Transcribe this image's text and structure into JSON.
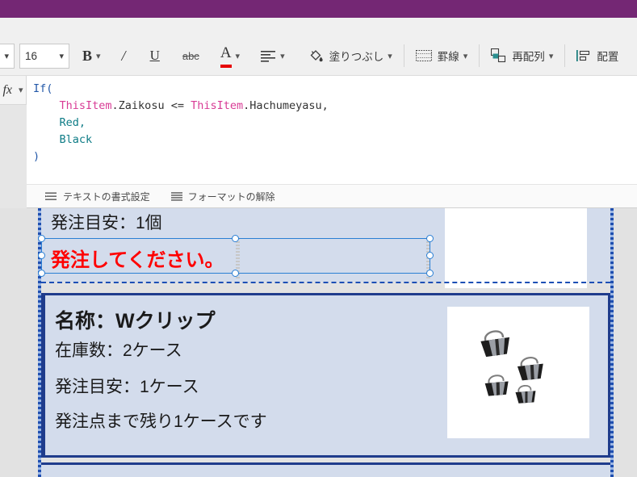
{
  "app": {
    "title_bar_color": "#742774",
    "canvas_bg": "#e2e2e2"
  },
  "toolbar": {
    "font_family_value": "",
    "font_size_value": "16",
    "bold_label": "B",
    "italic_label": "/",
    "underline_label": "U",
    "strikethrough_label": "abc",
    "font_color_label": "A",
    "font_color_swatch": "#e60000",
    "align_label": "",
    "fill_label": "塗りつぶし",
    "border_label": "罫線",
    "reorder_label": "再配列",
    "arrange_label": "配置"
  },
  "formula": {
    "fx_label": "fx",
    "lines": [
      [
        {
          "t": "If(",
          "c": "fn"
        }
      ],
      [
        {
          "t": "    ",
          "c": "plain"
        },
        {
          "t": "ThisItem",
          "c": "obj"
        },
        {
          "t": ".Zaikosu <= ",
          "c": "plain"
        },
        {
          "t": "ThisItem",
          "c": "obj"
        },
        {
          "t": ".Hachumeyasu,",
          "c": "plain"
        }
      ],
      [
        {
          "t": "    ",
          "c": "plain"
        },
        {
          "t": "Red,",
          "c": "val"
        }
      ],
      [
        {
          "t": "    ",
          "c": "plain"
        },
        {
          "t": "Black",
          "c": "val"
        }
      ],
      [
        {
          "t": ")",
          "c": "fn"
        }
      ]
    ],
    "text_format_label": "テキストの書式設定",
    "clear_format_label": "フォーマットの解除"
  },
  "gallery": {
    "items": [
      {
        "lines": [
          "発注目安：1個"
        ],
        "alert_text": "発注してください。",
        "alert_color": "#ff0000",
        "image_alt": "stapler-photo"
      },
      {
        "name_line": "名称：Wクリップ",
        "stock_line": "在庫数：2ケース",
        "reorder_line": "発注目安：1ケース",
        "remaining_line": "発注点まで残り1ケースです",
        "image_alt": "binder-clips-photo"
      }
    ],
    "selected_control": "発注してください。"
  }
}
